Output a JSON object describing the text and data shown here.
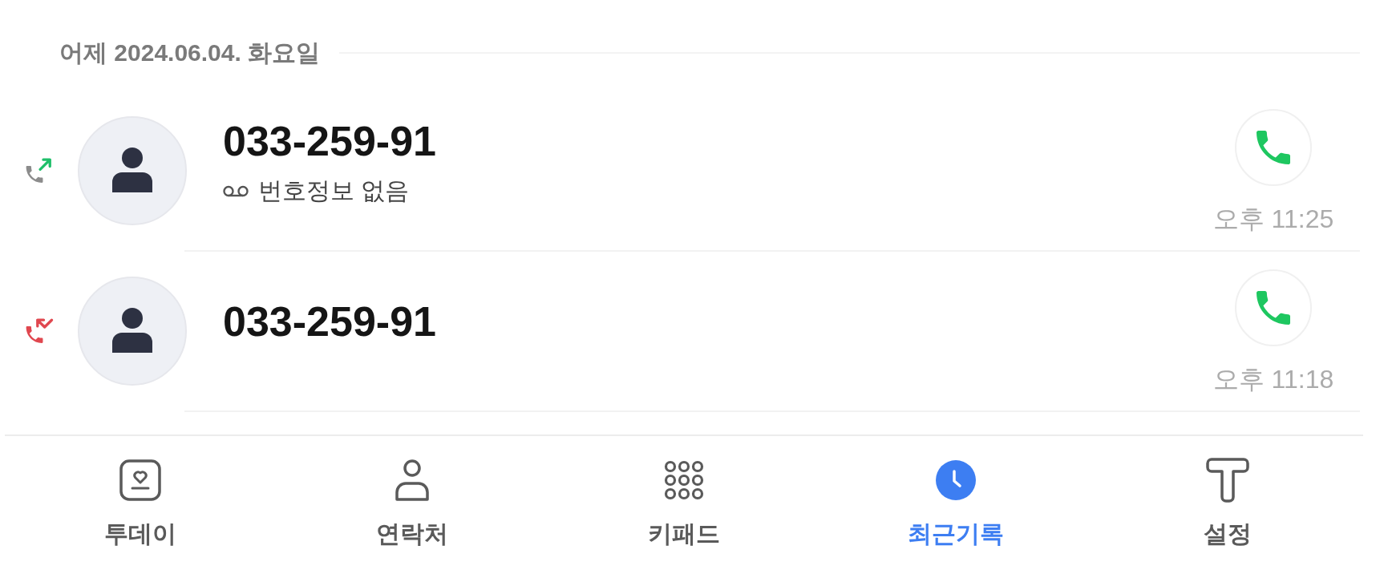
{
  "date_header": {
    "label": "어제 2024.06.04. 화요일"
  },
  "calls": [
    {
      "kind": "outgoing",
      "number": "033-259-91",
      "detail": "번호정보 없음",
      "time": "오후 11:25"
    },
    {
      "kind": "missed",
      "number": "033-259-91",
      "time": "오후 11:18"
    }
  ],
  "tab_bar": {
    "tabs": [
      {
        "label": "투데이",
        "selected": false
      },
      {
        "label": "연락처",
        "selected": false
      },
      {
        "label": "키패드",
        "selected": false
      },
      {
        "label": "최근기록",
        "selected": true
      },
      {
        "label": "설정",
        "selected": false
      }
    ]
  }
}
